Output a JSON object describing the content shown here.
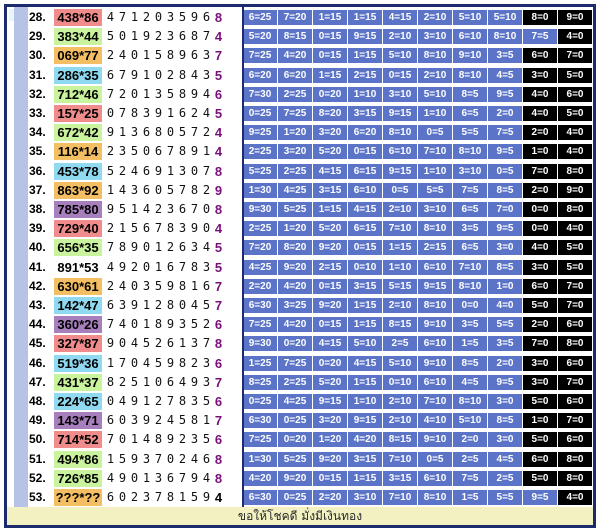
{
  "footer_text": "ขอให้โชคดี มั่งมีเงินทอง",
  "rows": [
    {
      "n": "28.",
      "pair": "438*86",
      "pairColor": "#f08c8c",
      "digits": "471203596",
      "tail": "8",
      "tailColor": "#7a0f7a",
      "cells": [
        "6=25",
        "7=20",
        "1=15",
        "1=15",
        "4=15",
        "2=10",
        "5=10",
        "5=10",
        "8=0",
        "9=0"
      ]
    },
    {
      "n": "29.",
      "pair": "383*44",
      "pairColor": "#c9f39c",
      "digits": "501923687",
      "tail": "4",
      "tailColor": "#7a0f7a",
      "cells": [
        "5=20",
        "8=15",
        "0=15",
        "9=15",
        "2=10",
        "3=10",
        "6=10",
        "8=10",
        "7=5",
        "4=0"
      ]
    },
    {
      "n": "30.",
      "pair": "069*77",
      "pairColor": "#f4be62",
      "digits": "240158963",
      "tail": "7",
      "tailColor": "#7a0f7a",
      "cells": [
        "7=25",
        "4=20",
        "0=15",
        "1=15",
        "5=10",
        "8=10",
        "9=10",
        "3=5",
        "6=0",
        "7=0"
      ]
    },
    {
      "n": "31.",
      "pair": "286*35",
      "pairColor": "#8fdaf1",
      "digits": "679102843",
      "tail": "5",
      "tailColor": "#7a0f7a",
      "cells": [
        "6=20",
        "6=20",
        "1=15",
        "2=15",
        "0=15",
        "2=10",
        "8=10",
        "4=5",
        "3=0",
        "5=0"
      ]
    },
    {
      "n": "32.",
      "pair": "712*46",
      "pairColor": "#c9f39c",
      "digits": "720135894",
      "tail": "6",
      "tailColor": "#7a0f7a",
      "cells": [
        "7=30",
        "2=25",
        "0=20",
        "1=10",
        "3=10",
        "5=10",
        "8=5",
        "9=5",
        "4=0",
        "6=0"
      ]
    },
    {
      "n": "33.",
      "pair": "157*25",
      "pairColor": "#f08c8c",
      "digits": "078391624",
      "tail": "5",
      "tailColor": "#7a0f7a",
      "cells": [
        "0=25",
        "7=25",
        "8=20",
        "3=15",
        "9=15",
        "1=10",
        "6=5",
        "2=0",
        "4=0",
        "5=0"
      ]
    },
    {
      "n": "34.",
      "pair": "672*42",
      "pairColor": "#c9f39c",
      "digits": "913680572",
      "tail": "4",
      "tailColor": "#7a0f7a",
      "cells": [
        "9=25",
        "1=20",
        "3=20",
        "6=20",
        "8=10",
        "0=5",
        "5=5",
        "7=5",
        "2=0",
        "4=0"
      ]
    },
    {
      "n": "35.",
      "pair": "116*14",
      "pairColor": "#f4be62",
      "digits": "235067891",
      "tail": "4",
      "tailColor": "#7a0f7a",
      "cells": [
        "2=25",
        "3=20",
        "5=20",
        "0=15",
        "6=10",
        "7=10",
        "8=10",
        "9=5",
        "1=0",
        "4=0"
      ]
    },
    {
      "n": "36.",
      "pair": "453*78",
      "pairColor": "#8fdaf1",
      "digits": "524691307",
      "tail": "8",
      "tailColor": "#7a0f7a",
      "cells": [
        "5=25",
        "2=25",
        "4=15",
        "6=15",
        "9=15",
        "1=10",
        "3=10",
        "0=5",
        "7=0",
        "8=0"
      ]
    },
    {
      "n": "37.",
      "pair": "863*92",
      "pairColor": "#f4be62",
      "digits": "143605782",
      "tail": "9",
      "tailColor": "#7a0f7a",
      "cells": [
        "1=30",
        "4=25",
        "3=15",
        "6=10",
        "0=5",
        "5=5",
        "7=5",
        "8=5",
        "2=0",
        "9=0"
      ]
    },
    {
      "n": "38.",
      "pair": "785*80",
      "pairColor": "#a77fbd",
      "digits": "951423670",
      "tail": "8",
      "tailColor": "#7a0f7a",
      "cells": [
        "9=30",
        "5=25",
        "1=15",
        "4=15",
        "2=10",
        "3=10",
        "6=5",
        "7=0",
        "0=0",
        "8=0"
      ]
    },
    {
      "n": "39.",
      "pair": "729*40",
      "pairColor": "#f08c8c",
      "digits": "215678390",
      "tail": "4",
      "tailColor": "#7a0f7a",
      "cells": [
        "2=25",
        "1=20",
        "5=20",
        "6=15",
        "7=10",
        "8=10",
        "3=5",
        "9=5",
        "0=0",
        "4=0"
      ]
    },
    {
      "n": "40.",
      "pair": "656*35",
      "pairColor": "#c9f39c",
      "digits": "789012634",
      "tail": "5",
      "tailColor": "#7a0f7a",
      "cells": [
        "7=20",
        "8=20",
        "9=20",
        "0=15",
        "1=15",
        "2=15",
        "6=5",
        "3=0",
        "4=0",
        "5=0"
      ]
    },
    {
      "n": "41.",
      "pair": "891*53",
      "pairColor": "#ffffff",
      "digits": "492016783",
      "tail": "5",
      "tailColor": "#7a0f7a",
      "cells": [
        "4=25",
        "9=20",
        "2=15",
        "0=10",
        "1=10",
        "6=10",
        "7=10",
        "8=5",
        "3=0",
        "5=0"
      ]
    },
    {
      "n": "42.",
      "pair": "630*61",
      "pairColor": "#f4be62",
      "digits": "240359816",
      "tail": "7",
      "tailColor": "#7a0f7a",
      "cells": [
        "2=20",
        "4=20",
        "0=15",
        "3=15",
        "5=15",
        "9=15",
        "8=10",
        "1=0",
        "6=0",
        "7=0"
      ]
    },
    {
      "n": "43.",
      "pair": "142*47",
      "pairColor": "#8fdaf1",
      "digits": "639128045",
      "tail": "7",
      "tailColor": "#7a0f7a",
      "cells": [
        "6=30",
        "3=25",
        "9=20",
        "1=15",
        "2=10",
        "8=10",
        "0=0",
        "4=0",
        "5=0",
        "7=0"
      ]
    },
    {
      "n": "44.",
      "pair": "360*26",
      "pairColor": "#a77fbd",
      "digits": "740189352",
      "tail": "6",
      "tailColor": "#7a0f7a",
      "cells": [
        "7=25",
        "4=20",
        "0=15",
        "1=15",
        "8=15",
        "9=10",
        "3=5",
        "5=5",
        "2=0",
        "6=0"
      ]
    },
    {
      "n": "45.",
      "pair": "327*87",
      "pairColor": "#f08c8c",
      "digits": "904526137",
      "tail": "8",
      "tailColor": "#7a0f7a",
      "cells": [
        "9=30",
        "0=20",
        "4=15",
        "5=10",
        "2=5",
        "6=10",
        "1=5",
        "3=5",
        "7=0",
        "8=0"
      ]
    },
    {
      "n": "46.",
      "pair": "519*36",
      "pairColor": "#8fdaf1",
      "digits": "170459823",
      "tail": "6",
      "tailColor": "#7a0f7a",
      "cells": [
        "1=25",
        "7=25",
        "0=20",
        "4=15",
        "5=10",
        "9=10",
        "8=5",
        "2=0",
        "3=0",
        "6=0"
      ]
    },
    {
      "n": "47.",
      "pair": "431*37",
      "pairColor": "#c9f39c",
      "digits": "825106493",
      "tail": "7",
      "tailColor": "#7a0f7a",
      "cells": [
        "8=25",
        "2=25",
        "5=20",
        "1=15",
        "0=10",
        "6=10",
        "4=5",
        "9=5",
        "3=0",
        "7=0"
      ]
    },
    {
      "n": "48.",
      "pair": "224*65",
      "pairColor": "#8fdaf1",
      "digits": "049127835",
      "tail": "6",
      "tailColor": "#7a0f7a",
      "cells": [
        "0=25",
        "4=25",
        "9=15",
        "1=10",
        "2=10",
        "7=10",
        "8=10",
        "3=0",
        "5=0",
        "6=0"
      ]
    },
    {
      "n": "49.",
      "pair": "143*71",
      "pairColor": "#a77fbd",
      "digits": "603924581",
      "tail": "7",
      "tailColor": "#7a0f7a",
      "cells": [
        "6=30",
        "0=25",
        "3=20",
        "9=15",
        "2=10",
        "4=10",
        "5=10",
        "8=5",
        "1=0",
        "7=0"
      ]
    },
    {
      "n": "50.",
      "pair": "714*52",
      "pairColor": "#f08c8c",
      "digits": "701489235",
      "tail": "6",
      "tailColor": "#7a0f7a",
      "cells": [
        "7=25",
        "0=20",
        "1=20",
        "4=20",
        "8=15",
        "9=10",
        "2=0",
        "3=0",
        "5=0",
        "6=0"
      ]
    },
    {
      "n": "51.",
      "pair": "494*86",
      "pairColor": "#c9f39c",
      "digits": "159370246",
      "tail": "8",
      "tailColor": "#7a0f7a",
      "cells": [
        "1=30",
        "5=25",
        "9=20",
        "3=15",
        "7=10",
        "0=5",
        "2=5",
        "4=5",
        "6=0",
        "8=0"
      ]
    },
    {
      "n": "52.",
      "pair": "726*85",
      "pairColor": "#c9f39c",
      "digits": "490136794",
      "tail": "8",
      "tailColor": "#7a0f7a",
      "cells": [
        "4=20",
        "9=20",
        "0=15",
        "1=15",
        "3=15",
        "6=10",
        "7=5",
        "2=5",
        "5=0",
        "8=0"
      ]
    },
    {
      "n": "53.",
      "pair": "???*??",
      "pairColor": "#f4be62",
      "digits": "602378159",
      "tail": "4",
      "tailColor": "#000000",
      "cells": [
        "6=30",
        "0=25",
        "2=20",
        "3=10",
        "7=10",
        "8=10",
        "1=5",
        "5=5",
        "9=5",
        "4=0"
      ]
    }
  ]
}
